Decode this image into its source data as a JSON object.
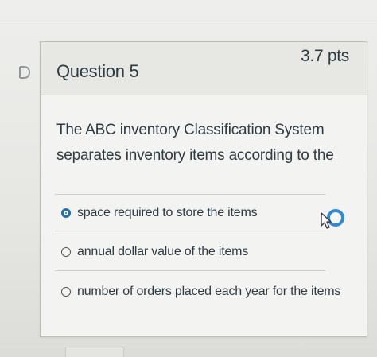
{
  "question": {
    "title": "Question 5",
    "points": "3.7 pts",
    "text_line_1": "The ABC inventory Classification System",
    "text_line_2": "separates inventory items according to the",
    "answers": [
      {
        "label": "space required to store the items",
        "selected": true
      },
      {
        "label": "annual dollar value of the items",
        "selected": false
      },
      {
        "label": "number of orders placed each year for the items",
        "selected": false
      }
    ]
  },
  "colors": {
    "text": "#2d3b45",
    "selected_radio": "#1c6fb8",
    "focus_ring": "#2d8ad6"
  },
  "icons": {
    "flag": "question-flag-icon",
    "cursor": "mouse-pointer-icon",
    "focus": "focus-ring-icon"
  }
}
